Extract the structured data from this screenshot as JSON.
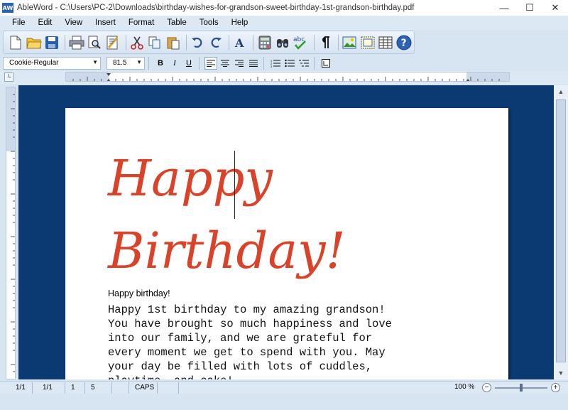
{
  "window": {
    "app_icon_text": "AW",
    "title": "AbleWord - C:\\Users\\PC-2\\Downloads\\birthday-wishes-for-grandson-sweet-birthday-1st-grandson-birthday.pdf",
    "minimize": "—",
    "maximize": "☐",
    "close": "✕"
  },
  "menu": [
    "File",
    "Edit",
    "View",
    "Insert",
    "Format",
    "Table",
    "Tools",
    "Help"
  ],
  "toolbar": {
    "icons": [
      "new-document-icon",
      "open-folder-icon",
      "save-icon",
      "print-icon",
      "print-preview-icon",
      "export-icon",
      "cut-icon",
      "copy-icon",
      "paste-icon",
      "undo-icon",
      "redo-icon",
      "font-icon",
      "calculator-icon",
      "find-icon",
      "spellcheck-icon",
      "pilcrow-icon",
      "insert-image-icon",
      "frame-icon",
      "table-icon",
      "help-icon"
    ]
  },
  "format": {
    "font_name": "Cookie-Regular",
    "font_size": "81.5",
    "bold": "B",
    "italic": "I",
    "underline": "U"
  },
  "document": {
    "heading_line1": "Happy",
    "heading_line2": "Birthday!",
    "subheading": "Happy birthday!",
    "body": "Happy 1st birthday to my amazing grandson! You have brought so much happiness and love into our family, and we are grateful for every moment we get to spend with you. May your day be filled with lots of cuddles, playtime, and cake!",
    "heading_color": "#d9432a"
  },
  "status": {
    "page": "1/1",
    "section": "1/1",
    "line": "1",
    "column": "5",
    "caps": "CAPS",
    "zoom": "100 %"
  },
  "colors": {
    "workspace": "#0b3a72",
    "accent": "#2a62b8"
  }
}
